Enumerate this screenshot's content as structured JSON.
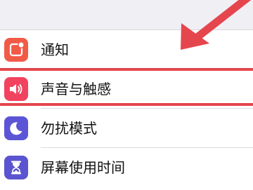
{
  "settings": {
    "items": [
      {
        "label": "通知",
        "icon": "notifications-icon",
        "color": "#f25a48"
      },
      {
        "label": "声音与触感",
        "icon": "speaker-icon",
        "color": "#f1435f"
      },
      {
        "label": "勿扰模式",
        "icon": "moon-icon",
        "color": "#5b55d6"
      },
      {
        "label": "屏幕使用时间",
        "icon": "hourglass-icon",
        "color": "#5a54d0"
      }
    ]
  },
  "annotation": {
    "highlight_color": "#e5464d",
    "highlighted_item": "声音与触感"
  }
}
